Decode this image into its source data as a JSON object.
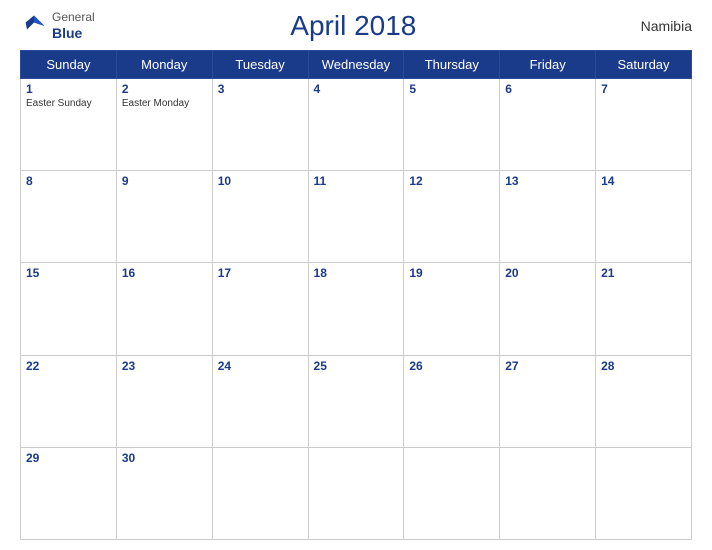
{
  "header": {
    "title": "April 2018",
    "country": "Namibia",
    "logo_general": "General",
    "logo_blue": "Blue"
  },
  "days_of_week": [
    "Sunday",
    "Monday",
    "Tuesday",
    "Wednesday",
    "Thursday",
    "Friday",
    "Saturday"
  ],
  "weeks": [
    [
      {
        "day": "1",
        "holiday": "Easter Sunday"
      },
      {
        "day": "2",
        "holiday": "Easter Monday"
      },
      {
        "day": "3",
        "holiday": ""
      },
      {
        "day": "4",
        "holiday": ""
      },
      {
        "day": "5",
        "holiday": ""
      },
      {
        "day": "6",
        "holiday": ""
      },
      {
        "day": "7",
        "holiday": ""
      }
    ],
    [
      {
        "day": "8",
        "holiday": ""
      },
      {
        "day": "9",
        "holiday": ""
      },
      {
        "day": "10",
        "holiday": ""
      },
      {
        "day": "11",
        "holiday": ""
      },
      {
        "day": "12",
        "holiday": ""
      },
      {
        "day": "13",
        "holiday": ""
      },
      {
        "day": "14",
        "holiday": ""
      }
    ],
    [
      {
        "day": "15",
        "holiday": ""
      },
      {
        "day": "16",
        "holiday": ""
      },
      {
        "day": "17",
        "holiday": ""
      },
      {
        "day": "18",
        "holiday": ""
      },
      {
        "day": "19",
        "holiday": ""
      },
      {
        "day": "20",
        "holiday": ""
      },
      {
        "day": "21",
        "holiday": ""
      }
    ],
    [
      {
        "day": "22",
        "holiday": ""
      },
      {
        "day": "23",
        "holiday": ""
      },
      {
        "day": "24",
        "holiday": ""
      },
      {
        "day": "25",
        "holiday": ""
      },
      {
        "day": "26",
        "holiday": ""
      },
      {
        "day": "27",
        "holiday": ""
      },
      {
        "day": "28",
        "holiday": ""
      }
    ],
    [
      {
        "day": "29",
        "holiday": ""
      },
      {
        "day": "30",
        "holiday": ""
      },
      {
        "day": "",
        "holiday": ""
      },
      {
        "day": "",
        "holiday": ""
      },
      {
        "day": "",
        "holiday": ""
      },
      {
        "day": "",
        "holiday": ""
      },
      {
        "day": "",
        "holiday": ""
      }
    ]
  ],
  "colors": {
    "header_bg": "#1a3a8a",
    "header_text": "#ffffff",
    "title_color": "#1a3a8a",
    "day_number_color": "#1a3a8a"
  }
}
